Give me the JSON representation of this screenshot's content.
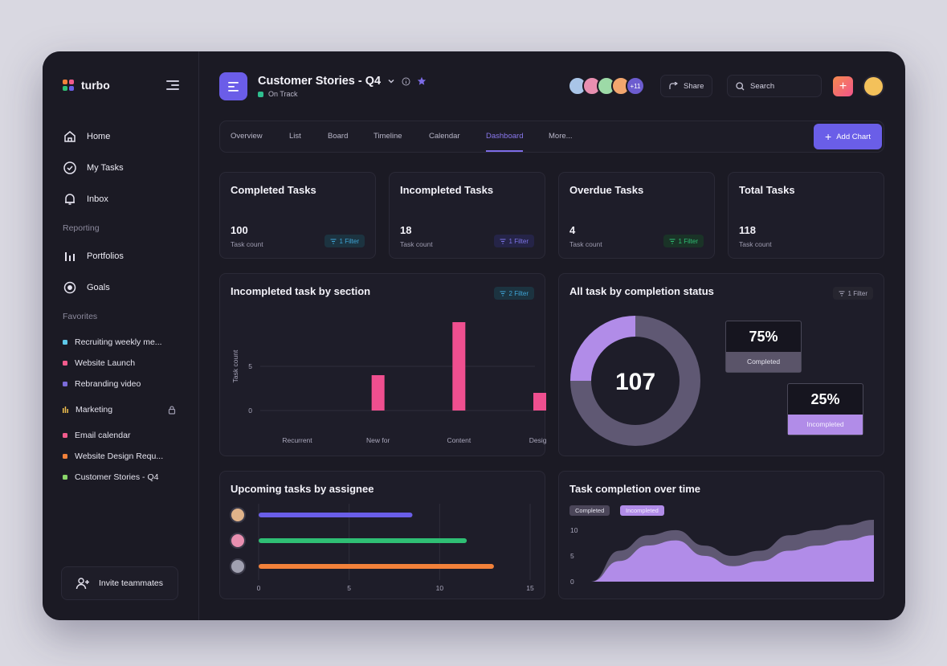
{
  "app": {
    "name": "turbo"
  },
  "sidebar": {
    "nav": [
      {
        "label": "Home",
        "icon": "home-icon"
      },
      {
        "label": "My Tasks",
        "icon": "check-circle-icon"
      },
      {
        "label": "Inbox",
        "icon": "bell-icon"
      }
    ],
    "reporting_label": "Reporting",
    "reporting": [
      {
        "label": "Portfolios",
        "icon": "bar-chart-icon"
      },
      {
        "label": "Goals",
        "icon": "target-icon"
      }
    ],
    "favorites_label": "Favorites",
    "favorites": [
      {
        "label": "Recruiting weekly me...",
        "color": "#5ec8e8"
      },
      {
        "label": "Website Launch",
        "color": "#f25b8c"
      },
      {
        "label": "Rebranding video",
        "color": "#7b6bd9"
      },
      {
        "label": "Marketing",
        "color": "#f2c14e"
      },
      {
        "label": "Email calendar",
        "color": "#f25b8c"
      },
      {
        "label": "Website Design Requ...",
        "color": "#f2813a"
      },
      {
        "label": "Customer Stories - Q4",
        "color": "#8ad66a"
      }
    ],
    "invite_label": "Invite teammates"
  },
  "header": {
    "title": "Customer Stories - Q4",
    "status": "On Track",
    "status_color": "#2fbf8f",
    "avatars_more": "+11",
    "share_label": "Share",
    "search_placeholder": "Search"
  },
  "tabs": [
    "Overview",
    "List",
    "Board",
    "Timeline",
    "Calendar",
    "Dashboard",
    "More..."
  ],
  "active_tab": "Dashboard",
  "add_chart_label": "Add Chart",
  "stats": [
    {
      "title": "Completed Tasks",
      "value": "100",
      "sub": "Task count",
      "filter": "1 Filter"
    },
    {
      "title": "Incompleted Tasks",
      "value": "18",
      "sub": "Task count",
      "filter": "1 Filter"
    },
    {
      "title": "Overdue Tasks",
      "value": "4",
      "sub": "Task count",
      "filter": "1 Filter"
    },
    {
      "title": "Total Tasks",
      "value": "118",
      "sub": "Task count"
    }
  ],
  "charts": {
    "by_section": {
      "title": "Incompleted task by section",
      "filter": "2 Filter"
    },
    "by_status": {
      "title": "All task by completion status",
      "filter": "1 Filter",
      "center": "107",
      "completed_pct": "75%",
      "completed_label": "Completed",
      "incompleted_pct": "25%",
      "incompleted_label": "Incompleted"
    },
    "by_assignee": {
      "title": "Upcoming tasks by assignee"
    },
    "over_time": {
      "title": "Task completion over time",
      "legend": [
        "Completed",
        "Incompleted"
      ]
    }
  },
  "chart_data": [
    {
      "type": "bar",
      "title": "Incompleted task by section",
      "categories": [
        "Recurrent",
        "New for",
        "Content",
        "Design"
      ],
      "values": [
        0,
        4,
        10,
        2
      ],
      "ylabel": "Task count",
      "yticks": [
        0,
        5
      ],
      "ylim": [
        0,
        10
      ],
      "color": "#ef4f8f"
    },
    {
      "type": "pie",
      "title": "All task by completion status",
      "labels": [
        "Completed",
        "Incompleted"
      ],
      "values": [
        75,
        25
      ],
      "colors": [
        "#5f5873",
        "#b18ce8"
      ]
    },
    {
      "type": "bar",
      "title": "Upcoming tasks by assignee",
      "orientation": "horizontal",
      "values": [
        8.5,
        11.5,
        13
      ],
      "colors": [
        "#6a5ee8",
        "#2fbf74",
        "#f2813a"
      ],
      "xticks": [
        0,
        5,
        10,
        15
      ],
      "xlim": [
        0,
        15
      ]
    },
    {
      "type": "area",
      "title": "Task completion over time",
      "yticks": [
        0,
        5,
        10
      ],
      "ylim": [
        0,
        12
      ],
      "series": [
        {
          "name": "Completed",
          "values": [
            0,
            6,
            9,
            10,
            7,
            5,
            6,
            9,
            10,
            11,
            12
          ],
          "color": "#5f5873"
        },
        {
          "name": "Incompleted",
          "values": [
            0,
            4,
            7,
            8,
            5,
            3,
            4,
            6,
            7,
            8,
            9
          ],
          "color": "#b18ce8"
        }
      ]
    }
  ]
}
